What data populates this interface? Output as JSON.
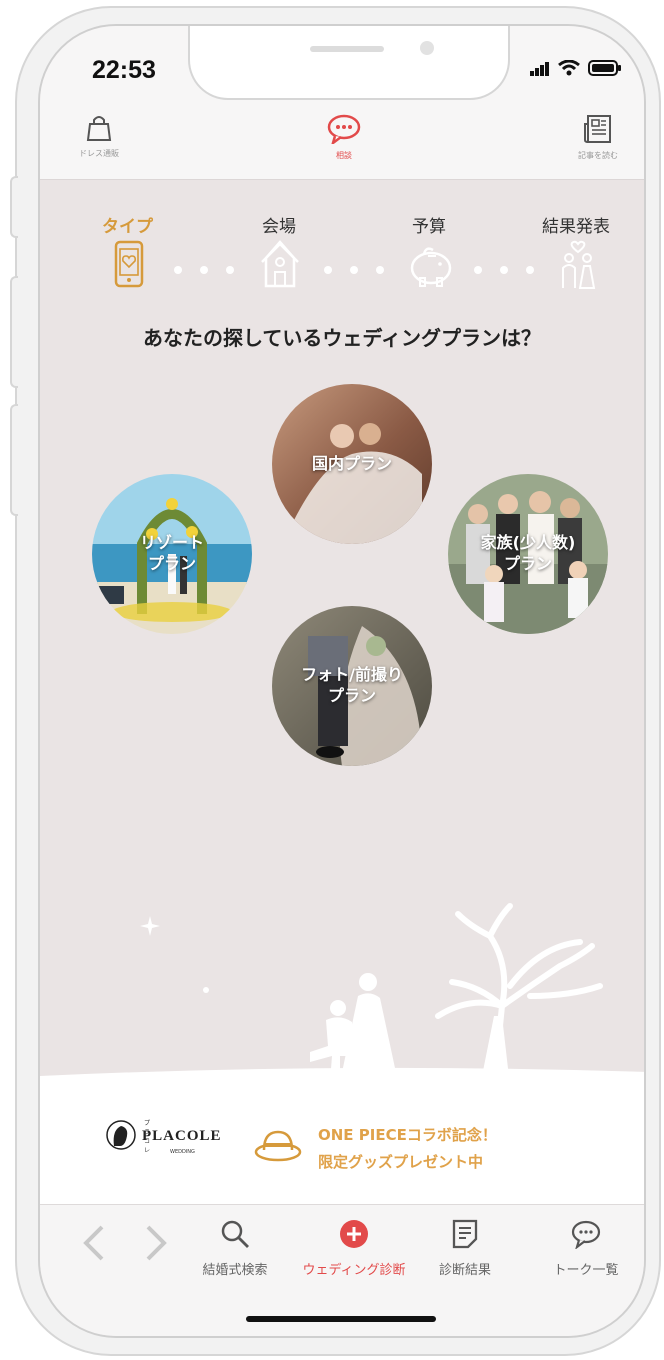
{
  "status_bar": {
    "time": "22:53"
  },
  "header": {
    "items": [
      {
        "label": "ドレス通販",
        "icon": "shopping-bag-icon"
      },
      {
        "label": "相談",
        "icon": "chat-icon",
        "active": true
      },
      {
        "label": "記事を読む",
        "icon": "newspaper-icon"
      }
    ]
  },
  "steps": [
    {
      "label": "タイプ",
      "icon": "phone-heart-icon",
      "active": true
    },
    {
      "label": "会場",
      "icon": "chapel-icon"
    },
    {
      "label": "予算",
      "icon": "piggy-bank-icon"
    },
    {
      "label": "結果発表",
      "icon": "couple-icon"
    }
  ],
  "question": "あなたの探しているウェディングプランは？",
  "plans": {
    "domestic": "国内プラン",
    "resort_line1": "リゾート",
    "resort_line2": "プラン",
    "family_line1": "家族(少人数)",
    "family_line2": "プラン",
    "photo_line1": "フォト/前撮り",
    "photo_line2": "プラン"
  },
  "banner": {
    "logo_ruby": "プラコレ",
    "logo_text": "PLACOLE",
    "logo_sub": "WEDDING",
    "promo_line1": "ONE PIECEコラボ記念！",
    "promo_line2": "限定グッズプレゼント中"
  },
  "toolbar": {
    "items": [
      {
        "label": "結婚式検索",
        "icon": "search-icon"
      },
      {
        "label": "ウェディング診断",
        "icon": "plus-circle-icon",
        "active": true
      },
      {
        "label": "診断結果",
        "icon": "document-icon"
      },
      {
        "label": "トーク一覧",
        "icon": "chat-bubble-icon"
      }
    ]
  },
  "colors": {
    "accent": "#e24a4a",
    "gold": "#d69a3b",
    "background": "#eae4e4"
  }
}
